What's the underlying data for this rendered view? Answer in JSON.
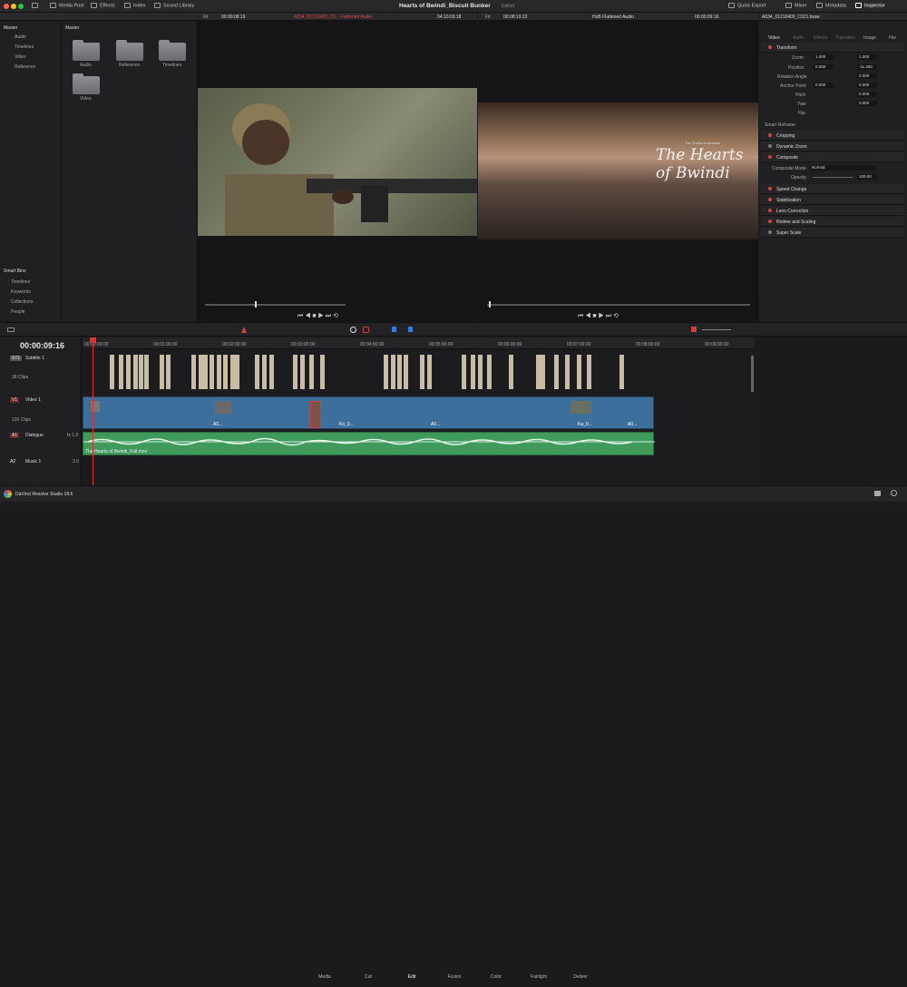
{
  "toolbar": {
    "media_pool": "Media Pool",
    "effects": "Effects",
    "index": "Index",
    "sound_library": "Sound Library",
    "project_title": "Hearts of Bwindi_Biscuit Bunker",
    "edited": "Edited",
    "quick_export": "Quick Export",
    "mixer": "Mixer",
    "metadata": "Metadata",
    "inspector": "Inspector"
  },
  "media_pool": {
    "tree_header": "Master",
    "tree": [
      "Audio",
      "Timelines",
      "Video",
      "Reference"
    ],
    "bin_header": "Master",
    "bins": [
      "Audio",
      "Reference",
      "Timelines",
      "Video"
    ],
    "smart_bins_header": "Smart Bins",
    "smart_bins": [
      "Timelines",
      "Keywords",
      "Collections",
      "People"
    ]
  },
  "source_viewer": {
    "fit": "Fit",
    "timecode": "00:00:08:19",
    "clip_name": "A034_01210409_C0... Flattened Audio",
    "duration": "04:10:03:18"
  },
  "timeline_viewer": {
    "fit": "Fit",
    "timecode": "00:08:19:22",
    "timeline_name": "HoB Flattened Audio",
    "position": "00:00:09:16",
    "title_line1": "The Hearts",
    "title_line2": "of Bwindi",
    "title_small": "The Gorilla Guardians"
  },
  "inspector": {
    "clip_name": "A034_01210409_C021.braw",
    "tabs": [
      "Video",
      "Audio",
      "Effects",
      "Transition",
      "Image",
      "File"
    ],
    "transform": "Transform",
    "zoom_label": "Zoom",
    "zoom_x": "1.000",
    "zoom_y": "1.000",
    "position_label": "Position",
    "position_x": "0.000",
    "position_y": "-11.250",
    "rotation_label": "Rotation Angle",
    "rotation": "0.000",
    "anchor_label": "Anchor Point",
    "anchor_x": "0.000",
    "anchor_y": "0.000",
    "pitch_label": "Pitch",
    "pitch": "0.000",
    "yaw_label": "Yaw",
    "yaw": "0.000",
    "flip_label": "Flip",
    "smart_reframe": "Smart Reframe",
    "cropping": "Cropping",
    "dynamic_zoom": "Dynamic Zoom",
    "composite": "Composite",
    "composite_mode_label": "Composite Mode",
    "composite_mode": "Normal",
    "opacity_label": "Opacity",
    "opacity": "100.00",
    "speed_change": "Speed Change",
    "stabilization": "Stabilization",
    "lens_correction": "Lens Correction",
    "retime_scaling": "Retime and Scaling",
    "super_scale": "Super Scale"
  },
  "timeline": {
    "timecode": "00:00:09:16",
    "ruler": [
      "00:00:00:00",
      "00:01:00:00",
      "00:02:00:00",
      "00:03:00:00",
      "00:04:00:00",
      "00:05:00:00",
      "00:06:00:00",
      "00:07:00:00",
      "00:08:00:00",
      "00:09:00:00"
    ],
    "tracks": {
      "st1_id": "ST1",
      "st1_name": "Subtitle 1",
      "st1_clips": "38 Clips",
      "v1_id": "V1",
      "v1_name": "Video 1",
      "v1_clips": "126 Clips",
      "a1_id": "A1",
      "a1_name": "Dialogue",
      "a1_fx": "fx 1.0",
      "a2_id": "A2",
      "a2_name": "Music 1",
      "a2_level": "2.0"
    },
    "audio_clip": "The Hearts of Bwindi_Full.mov",
    "clip_labels": [
      "A0...",
      "Ko_0...",
      "A0...",
      "Ka_0...",
      "A0..."
    ]
  },
  "footer": {
    "app": "DaVinci Resolve Studio 18.6",
    "pages": [
      "Media",
      "Cut",
      "Edit",
      "Fusion",
      "Color",
      "Fairlight",
      "Deliver"
    ],
    "active_page": "Edit"
  },
  "colors": {
    "accent_red": "#c03030",
    "subtitle": "#c8bda3",
    "video": "#3d6f9c",
    "audio": "#3f9a5c"
  }
}
